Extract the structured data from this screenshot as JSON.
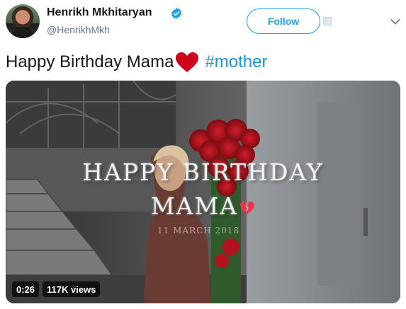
{
  "user": {
    "display_name": "Henrikh Mkhitaryan",
    "handle": "@HenrikhMkh",
    "verified": true
  },
  "actions": {
    "follow_label": "Follow"
  },
  "tweet": {
    "text": "Happy Birthday Mama",
    "hashtag": "#mother"
  },
  "video": {
    "overlay_line1": "HAPPY BIRTHDAY",
    "overlay_line2": "MAMA",
    "overlay_date": "11 MARCH 2018",
    "duration": "0:26",
    "views": "117K views"
  },
  "colors": {
    "accent": "#1da1f2",
    "hashtag": "#1b95e0",
    "heart": "#d0021b",
    "text": "#14171a",
    "muted": "#657786"
  },
  "icons": {
    "verified": "verified-badge-icon",
    "heart": "red-heart-icon",
    "chevron": "chevron-down-icon"
  }
}
